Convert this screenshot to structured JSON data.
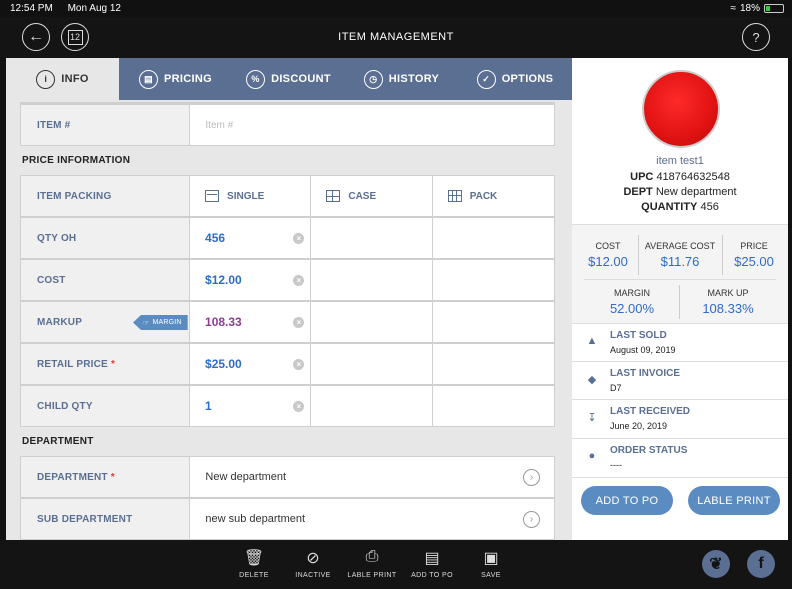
{
  "status": {
    "time": "12:54 PM",
    "date": "Mon Aug 12",
    "battery": "18%"
  },
  "header": {
    "title": "ITEM MANAGEMENT",
    "calendar_day": "12",
    "help": "?"
  },
  "tabs": [
    {
      "label": "INFO",
      "icon": "i"
    },
    {
      "label": "PRICING",
      "icon": "$"
    },
    {
      "label": "DISCOUNT",
      "icon": "%"
    },
    {
      "label": "HISTORY",
      "icon": "clock"
    },
    {
      "label": "OPTIONS",
      "icon": "check"
    }
  ],
  "form": {
    "item_no": {
      "label": "ITEM #",
      "placeholder": "Item #"
    },
    "price_info_title": "PRICE INFORMATION",
    "packing": {
      "label": "ITEM PACKING",
      "single": "SINGLE",
      "case": "CASE",
      "pack": "PACK"
    },
    "qty_oh": {
      "label": "QTY OH",
      "value": "456"
    },
    "cost": {
      "label": "COST",
      "value": "$12.00"
    },
    "markup": {
      "label": "MARKUP",
      "badge": "MARGIN",
      "value": "108.33"
    },
    "retail": {
      "label": "RETAIL PRICE",
      "required": "*",
      "value": "$25.00"
    },
    "child_qty": {
      "label": "CHILD QTY",
      "value": "1"
    },
    "department_title": "DEPARTMENT",
    "department": {
      "label": "DEPARTMENT",
      "required": "*",
      "value": "New department"
    },
    "sub_department": {
      "label": "SUB DEPARTMENT",
      "value": "new sub department"
    }
  },
  "summary": {
    "name": "item test1",
    "upc_label": "UPC",
    "upc": "418764632548",
    "dept_label": "DEPT",
    "dept": "New department",
    "qty_label": "QUANTITY",
    "qty": "456",
    "cost_label": "COST",
    "cost": "$12.00",
    "avg_cost_label": "AVERAGE COST",
    "avg_cost": "$11.76",
    "price_label": "PRICE",
    "price": "$25.00",
    "margin_label": "MARGIN",
    "margin": "52.00%",
    "markup_label": "MARK UP",
    "markup": "108.33%",
    "last_sold_label": "LAST SOLD",
    "last_sold": "August 09, 2019",
    "last_invoice_label": "LAST INVOICE",
    "last_invoice": "D7",
    "last_received_label": "LAST RECEIVED",
    "last_received": "June 20, 2019",
    "order_status_label": "ORDER STATUS",
    "order_status": "----",
    "add_to_po": "ADD TO PO",
    "label_print": "LABLE PRINT"
  },
  "bottom": {
    "delete": "DELETE",
    "inactive": "INACTIVE",
    "label_print": "LABLE PRINT",
    "add_to_po": "ADD TO PO",
    "save": "SAVE"
  },
  "colors": {
    "accent": "#5b6f92",
    "button": "#5b8cc1",
    "value": "#2f6bc8",
    "required": "#e03b3b"
  }
}
